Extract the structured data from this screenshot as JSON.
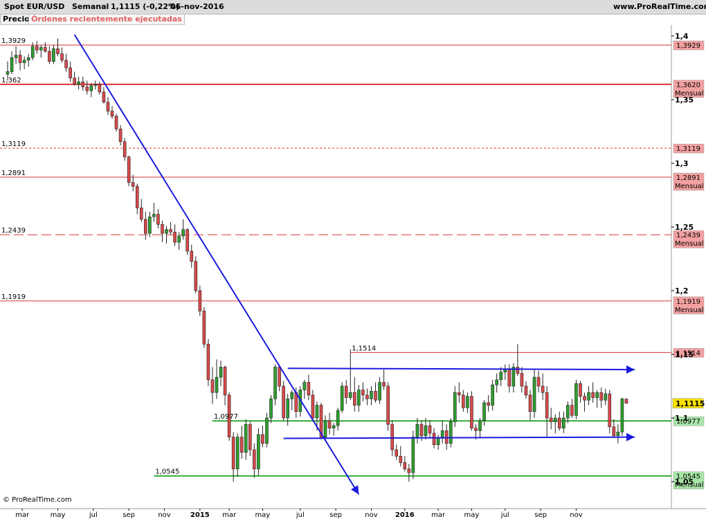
{
  "header": {
    "instrument": "Spot EUR/USD",
    "timeframe": "Semanal",
    "quote": "1,1115 (-0,22%)",
    "date": "06-nov-2016",
    "website": "www.ProRealTime.com"
  },
  "tabs": {
    "price_label": "Precio",
    "orders_label": "Órdenes recientemente ejecutadas"
  },
  "footer": {
    "copyright": "© ProRealTime.com"
  },
  "colors": {
    "up_candle": "#2e9e2e",
    "down_candle": "#d94a4a",
    "red_line": "#dd3333",
    "green_line": "#33aa33",
    "trend_line": "#1a1ae0",
    "last_price_bg": "#f5e200"
  },
  "chart_data": {
    "type": "candlestick",
    "instrument": "Spot EUR/USD",
    "timeframe": "Semanal",
    "y_range": [
      1.036,
      1.412
    ],
    "y_ticks": [
      {
        "value": 1.4,
        "label": "1,4"
      },
      {
        "value": 1.35,
        "label": "1,35"
      },
      {
        "value": 1.3,
        "label": "1,3"
      },
      {
        "value": 1.25,
        "label": "1,25"
      },
      {
        "value": 1.2,
        "label": "1,2"
      },
      {
        "value": 1.15,
        "label": "1,15"
      },
      {
        "value": 1.1,
        "label": "1,1"
      },
      {
        "value": 1.05,
        "label": "1,05"
      }
    ],
    "x_labels": [
      "mar",
      "may",
      "jul",
      "sep",
      "nov",
      "2015",
      "mar",
      "may",
      "jul",
      "sep",
      "nov",
      "2016",
      "mar",
      "may",
      "jul",
      "sep",
      "nov"
    ],
    "x_label_weeks": [
      3.5,
      12,
      20.5,
      29,
      37.5,
      46,
      53,
      61,
      70,
      78.5,
      87,
      95,
      103,
      111,
      119,
      127.5,
      136
    ],
    "bold_x_labels": [
      "2015",
      "2016"
    ],
    "candles": [
      [
        1.37,
        1.38,
        1.365,
        1.372
      ],
      [
        1.372,
        1.388,
        1.37,
        1.383
      ],
      [
        1.383,
        1.392,
        1.378,
        1.385
      ],
      [
        1.385,
        1.389,
        1.373,
        1.379
      ],
      [
        1.379,
        1.384,
        1.374,
        1.381
      ],
      [
        1.381,
        1.386,
        1.376,
        1.383
      ],
      [
        1.383,
        1.395,
        1.381,
        1.392
      ],
      [
        1.392,
        1.396,
        1.386,
        1.389
      ],
      [
        1.389,
        1.393,
        1.383,
        1.391
      ],
      [
        1.391,
        1.395,
        1.387,
        1.388
      ],
      [
        1.388,
        1.392,
        1.378,
        1.38
      ],
      [
        1.38,
        1.393,
        1.378,
        1.39
      ],
      [
        1.39,
        1.398,
        1.384,
        1.386
      ],
      [
        1.386,
        1.391,
        1.379,
        1.381
      ],
      [
        1.381,
        1.386,
        1.372,
        1.375
      ],
      [
        1.375,
        1.38,
        1.364,
        1.367
      ],
      [
        1.367,
        1.372,
        1.361,
        1.362
      ],
      [
        1.362,
        1.368,
        1.358,
        1.364
      ],
      [
        1.364,
        1.368,
        1.357,
        1.36
      ],
      [
        1.36,
        1.365,
        1.354,
        1.357
      ],
      [
        1.357,
        1.363,
        1.352,
        1.361
      ],
      [
        1.361,
        1.365,
        1.358,
        1.362
      ],
      [
        1.362,
        1.364,
        1.354,
        1.356
      ],
      [
        1.356,
        1.36,
        1.347,
        1.348
      ],
      [
        1.348,
        1.352,
        1.338,
        1.341
      ],
      [
        1.341,
        1.345,
        1.335,
        1.337
      ],
      [
        1.337,
        1.339,
        1.325,
        1.327
      ],
      [
        1.327,
        1.33,
        1.314,
        1.317
      ],
      [
        1.317,
        1.32,
        1.302,
        1.305
      ],
      [
        1.305,
        1.306,
        1.282,
        1.285
      ],
      [
        1.285,
        1.291,
        1.278,
        1.282
      ],
      [
        1.282,
        1.284,
        1.26,
        1.265
      ],
      [
        1.265,
        1.272,
        1.254,
        1.256
      ],
      [
        1.256,
        1.262,
        1.24,
        1.245
      ],
      [
        1.245,
        1.262,
        1.242,
        1.258
      ],
      [
        1.258,
        1.269,
        1.254,
        1.26
      ],
      [
        1.26,
        1.264,
        1.249,
        1.252
      ],
      [
        1.252,
        1.255,
        1.238,
        1.245
      ],
      [
        1.245,
        1.251,
        1.237,
        1.248
      ],
      [
        1.248,
        1.254,
        1.244,
        1.246
      ],
      [
        1.246,
        1.252,
        1.235,
        1.238
      ],
      [
        1.238,
        1.246,
        1.232,
        1.243
      ],
      [
        1.243,
        1.256,
        1.24,
        1.248
      ],
      [
        1.248,
        1.249,
        1.228,
        1.231
      ],
      [
        1.231,
        1.236,
        1.218,
        1.223
      ],
      [
        1.223,
        1.227,
        1.198,
        1.2
      ],
      [
        1.2,
        1.204,
        1.18,
        1.184
      ],
      [
        1.184,
        1.187,
        1.155,
        1.158
      ],
      [
        1.158,
        1.162,
        1.125,
        1.13
      ],
      [
        1.13,
        1.14,
        1.111,
        1.12
      ],
      [
        1.12,
        1.146,
        1.115,
        1.132
      ],
      [
        1.132,
        1.145,
        1.125,
        1.14
      ],
      [
        1.14,
        1.141,
        1.11,
        1.118
      ],
      [
        1.118,
        1.12,
        1.082,
        1.085
      ],
      [
        1.085,
        1.089,
        1.05,
        1.06
      ],
      [
        1.06,
        1.088,
        1.054,
        1.085
      ],
      [
        1.085,
        1.094,
        1.068,
        1.073
      ],
      [
        1.073,
        1.099,
        1.067,
        1.095
      ],
      [
        1.095,
        1.097,
        1.07,
        1.075
      ],
      [
        1.075,
        1.08,
        1.053,
        1.06
      ],
      [
        1.06,
        1.092,
        1.055,
        1.087
      ],
      [
        1.087,
        1.094,
        1.077,
        1.08
      ],
      [
        1.08,
        1.104,
        1.077,
        1.1
      ],
      [
        1.1,
        1.118,
        1.096,
        1.115
      ],
      [
        1.115,
        1.142,
        1.11,
        1.14
      ],
      [
        1.14,
        1.142,
        1.121,
        1.125
      ],
      [
        1.125,
        1.129,
        1.098,
        1.1
      ],
      [
        1.1,
        1.119,
        1.094,
        1.115
      ],
      [
        1.115,
        1.122,
        1.106,
        1.12
      ],
      [
        1.12,
        1.124,
        1.1,
        1.105
      ],
      [
        1.105,
        1.125,
        1.101,
        1.122
      ],
      [
        1.122,
        1.13,
        1.115,
        1.128
      ],
      [
        1.128,
        1.134,
        1.114,
        1.118
      ],
      [
        1.118,
        1.122,
        1.098,
        1.1
      ],
      [
        1.1,
        1.113,
        1.09,
        1.11
      ],
      [
        1.11,
        1.112,
        1.083,
        1.085
      ],
      [
        1.085,
        1.102,
        1.082,
        1.098
      ],
      [
        1.098,
        1.104,
        1.087,
        1.092
      ],
      [
        1.092,
        1.096,
        1.086,
        1.094
      ],
      [
        1.094,
        1.108,
        1.09,
        1.106
      ],
      [
        1.106,
        1.128,
        1.104,
        1.125
      ],
      [
        1.125,
        1.13,
        1.111,
        1.116
      ],
      [
        1.116,
        1.154,
        1.114,
        1.12
      ],
      [
        1.12,
        1.132,
        1.105,
        1.11
      ],
      [
        1.11,
        1.126,
        1.105,
        1.122
      ],
      [
        1.122,
        1.128,
        1.113,
        1.118
      ],
      [
        1.118,
        1.123,
        1.11,
        1.115
      ],
      [
        1.115,
        1.125,
        1.11,
        1.121
      ],
      [
        1.121,
        1.128,
        1.112,
        1.114
      ],
      [
        1.114,
        1.132,
        1.111,
        1.128
      ],
      [
        1.128,
        1.138,
        1.122,
        1.125
      ],
      [
        1.125,
        1.128,
        1.09,
        1.095
      ],
      [
        1.095,
        1.098,
        1.07,
        1.075
      ],
      [
        1.075,
        1.079,
        1.067,
        1.07
      ],
      [
        1.07,
        1.078,
        1.062,
        1.065
      ],
      [
        1.065,
        1.07,
        1.058,
        1.06
      ],
      [
        1.06,
        1.064,
        1.05,
        1.057
      ],
      [
        1.057,
        1.09,
        1.052,
        1.085
      ],
      [
        1.085,
        1.1,
        1.08,
        1.095
      ],
      [
        1.095,
        1.098,
        1.082,
        1.086
      ],
      [
        1.086,
        1.1,
        1.083,
        1.094
      ],
      [
        1.094,
        1.098,
        1.084,
        1.088
      ],
      [
        1.088,
        1.092,
        1.076,
        1.079
      ],
      [
        1.079,
        1.087,
        1.075,
        1.084
      ],
      [
        1.084,
        1.098,
        1.08,
        1.09
      ],
      [
        1.09,
        1.095,
        1.075,
        1.08
      ],
      [
        1.08,
        1.1,
        1.077,
        1.097
      ],
      [
        1.097,
        1.125,
        1.093,
        1.12
      ],
      [
        1.12,
        1.128,
        1.112,
        1.118
      ],
      [
        1.118,
        1.122,
        1.105,
        1.108
      ],
      [
        1.108,
        1.12,
        1.104,
        1.117
      ],
      [
        1.117,
        1.121,
        1.09,
        1.092
      ],
      [
        1.092,
        1.095,
        1.083,
        1.09
      ],
      [
        1.09,
        1.1,
        1.085,
        1.098
      ],
      [
        1.098,
        1.114,
        1.094,
        1.112
      ],
      [
        1.112,
        1.118,
        1.105,
        1.11
      ],
      [
        1.11,
        1.13,
        1.106,
        1.126
      ],
      [
        1.126,
        1.135,
        1.12,
        1.13
      ],
      [
        1.13,
        1.14,
        1.125,
        1.136
      ],
      [
        1.136,
        1.142,
        1.13,
        1.138
      ],
      [
        1.138,
        1.142,
        1.12,
        1.125
      ],
      [
        1.125,
        1.143,
        1.12,
        1.14
      ],
      [
        1.14,
        1.158,
        1.133,
        1.135
      ],
      [
        1.135,
        1.14,
        1.12,
        1.125
      ],
      [
        1.125,
        1.129,
        1.115,
        1.118
      ],
      [
        1.118,
        1.122,
        1.098,
        1.105
      ],
      [
        1.105,
        1.138,
        1.1,
        1.132
      ],
      [
        1.132,
        1.137,
        1.12,
        1.125
      ],
      [
        1.125,
        1.135,
        1.114,
        1.12
      ],
      [
        1.12,
        1.125,
        1.085,
        1.1
      ],
      [
        1.1,
        1.108,
        1.091,
        1.097
      ],
      [
        1.097,
        1.103,
        1.088,
        1.1
      ],
      [
        1.1,
        1.105,
        1.09,
        1.092
      ],
      [
        1.092,
        1.105,
        1.088,
        1.1
      ],
      [
        1.1,
        1.113,
        1.096,
        1.11
      ],
      [
        1.11,
        1.115,
        1.1,
        1.102
      ],
      [
        1.102,
        1.13,
        1.099,
        1.127
      ],
      [
        1.127,
        1.129,
        1.112,
        1.117
      ],
      [
        1.117,
        1.12,
        1.105,
        1.114
      ],
      [
        1.114,
        1.125,
        1.11,
        1.12
      ],
      [
        1.12,
        1.128,
        1.112,
        1.116
      ],
      [
        1.116,
        1.122,
        1.108,
        1.12
      ],
      [
        1.12,
        1.124,
        1.108,
        1.114
      ],
      [
        1.114,
        1.123,
        1.11,
        1.119
      ],
      [
        1.119,
        1.122,
        1.088,
        1.093
      ],
      [
        1.093,
        1.099,
        1.085,
        1.086
      ],
      [
        1.086,
        1.095,
        1.08,
        1.089
      ],
      [
        1.089,
        1.116,
        1.086,
        1.115
      ],
      [
        1.115,
        1.115,
        1.112,
        1.1115
      ]
    ],
    "levels": [
      {
        "value": 1.3929,
        "left_label": "1,3929",
        "right_label": "1,3929",
        "tag": "",
        "color": "red",
        "style": "solid",
        "width": 1
      },
      {
        "value": 1.362,
        "left_label": "1,362",
        "right_label": "1,3620",
        "tag": "Mensual",
        "color": "red",
        "style": "solid",
        "width": 2
      },
      {
        "value": 1.3119,
        "left_label": "1,3119",
        "right_label": "1,3119",
        "tag": "",
        "color": "red",
        "style": "dotted",
        "width": 1
      },
      {
        "value": 1.2891,
        "left_label": "1,2891",
        "right_label": "1,2891",
        "tag": "Mensual",
        "color": "red",
        "style": "solid",
        "width": 1
      },
      {
        "value": 1.2439,
        "left_label": "1,2439",
        "right_label": "1,2439",
        "tag": "Mensual",
        "color": "red",
        "style": "dashed",
        "width": 1
      },
      {
        "value": 1.1919,
        "left_label": "1,1919",
        "right_label": "1,1919",
        "tag": "Mensual",
        "color": "red",
        "style": "solid",
        "width": 1
      },
      {
        "value": 1.1514,
        "left_label": "1,1514",
        "right_label": "1,1514",
        "tag": "",
        "color": "red",
        "style": "solid",
        "width": 1,
        "start_week": 82
      },
      {
        "value": 1.0977,
        "left_label": "1,0977",
        "right_label": "1,0977",
        "tag": "",
        "color": "green",
        "style": "solid",
        "width": 2,
        "start_week": 49
      },
      {
        "value": 1.0545,
        "left_label": "1,0545",
        "right_label": "1,0545",
        "tag": "Mensual",
        "color": "green",
        "style": "solid",
        "width": 2,
        "start_week": 35
      }
    ],
    "last_price": {
      "value": 1.1115,
      "label": "1,1115"
    },
    "trendlines": [
      {
        "from": [
          16,
          1.401
        ],
        "to": [
          84,
          1.04
        ],
        "arrow": true
      },
      {
        "from": [
          67,
          1.139
        ],
        "to": [
          150,
          1.138
        ],
        "arrow": true
      },
      {
        "from": [
          66,
          1.084
        ],
        "to": [
          150,
          1.085
        ],
        "arrow": true
      }
    ]
  }
}
